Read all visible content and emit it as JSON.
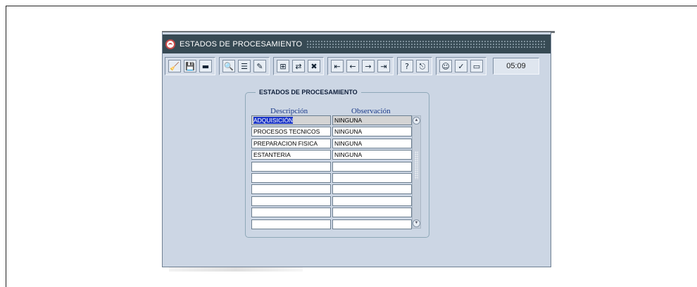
{
  "window": {
    "title": "ESTADOS DE PROCESAMIENTO"
  },
  "toolbar": {
    "groups": [
      [
        {
          "name": "broom-icon",
          "glyph": "🧹"
        },
        {
          "name": "save-icon",
          "glyph": "💾"
        },
        {
          "name": "printer-icon",
          "glyph": "▬"
        }
      ],
      [
        {
          "name": "magnifier-icon",
          "glyph": "🔍"
        },
        {
          "name": "list-icon",
          "glyph": "☰"
        },
        {
          "name": "edit-icon",
          "glyph": "✎"
        }
      ],
      [
        {
          "name": "insert-record-icon",
          "glyph": "⊞"
        },
        {
          "name": "duplicate-record-icon",
          "glyph": "⇄"
        },
        {
          "name": "delete-record-icon",
          "glyph": "✖"
        }
      ],
      [
        {
          "name": "first-record-icon",
          "glyph": "⇤"
        },
        {
          "name": "previous-record-icon",
          "glyph": "←"
        },
        {
          "name": "next-record-icon",
          "glyph": "→"
        },
        {
          "name": "last-record-icon",
          "glyph": "⇥"
        }
      ],
      [
        {
          "name": "help-icon",
          "glyph": "?"
        },
        {
          "name": "exit-icon",
          "glyph": "⎋"
        }
      ],
      [
        {
          "name": "user-icon",
          "glyph": "☺"
        },
        {
          "name": "check-icon",
          "glyph": "✓"
        },
        {
          "name": "calendar-icon",
          "glyph": "▭"
        }
      ]
    ],
    "clock": "05:09"
  },
  "form": {
    "frame_title": "ESTADOS DE PROCESAMIENTO",
    "columns": {
      "descripcion": "Descripción",
      "observacion": "Observación"
    },
    "rows": [
      {
        "descripcion": "ADQUISICIÓN",
        "observacion": "NINGUNA"
      },
      {
        "descripcion": "PROCESOS TECNICOS",
        "observacion": "NINGUNA"
      },
      {
        "descripcion": "PREPARACION FISICA",
        "observacion": "NINGUNA"
      },
      {
        "descripcion": "ESTANTERIA",
        "observacion": "NINGUNA"
      },
      {
        "descripcion": "",
        "observacion": ""
      },
      {
        "descripcion": "",
        "observacion": ""
      },
      {
        "descripcion": "",
        "observacion": ""
      },
      {
        "descripcion": "",
        "observacion": ""
      },
      {
        "descripcion": "",
        "observacion": ""
      },
      {
        "descripcion": "",
        "observacion": ""
      }
    ]
  },
  "colors": {
    "titlebar": "#374a54",
    "window_bg": "#ccd6e4",
    "selection": "#1a35c8"
  }
}
